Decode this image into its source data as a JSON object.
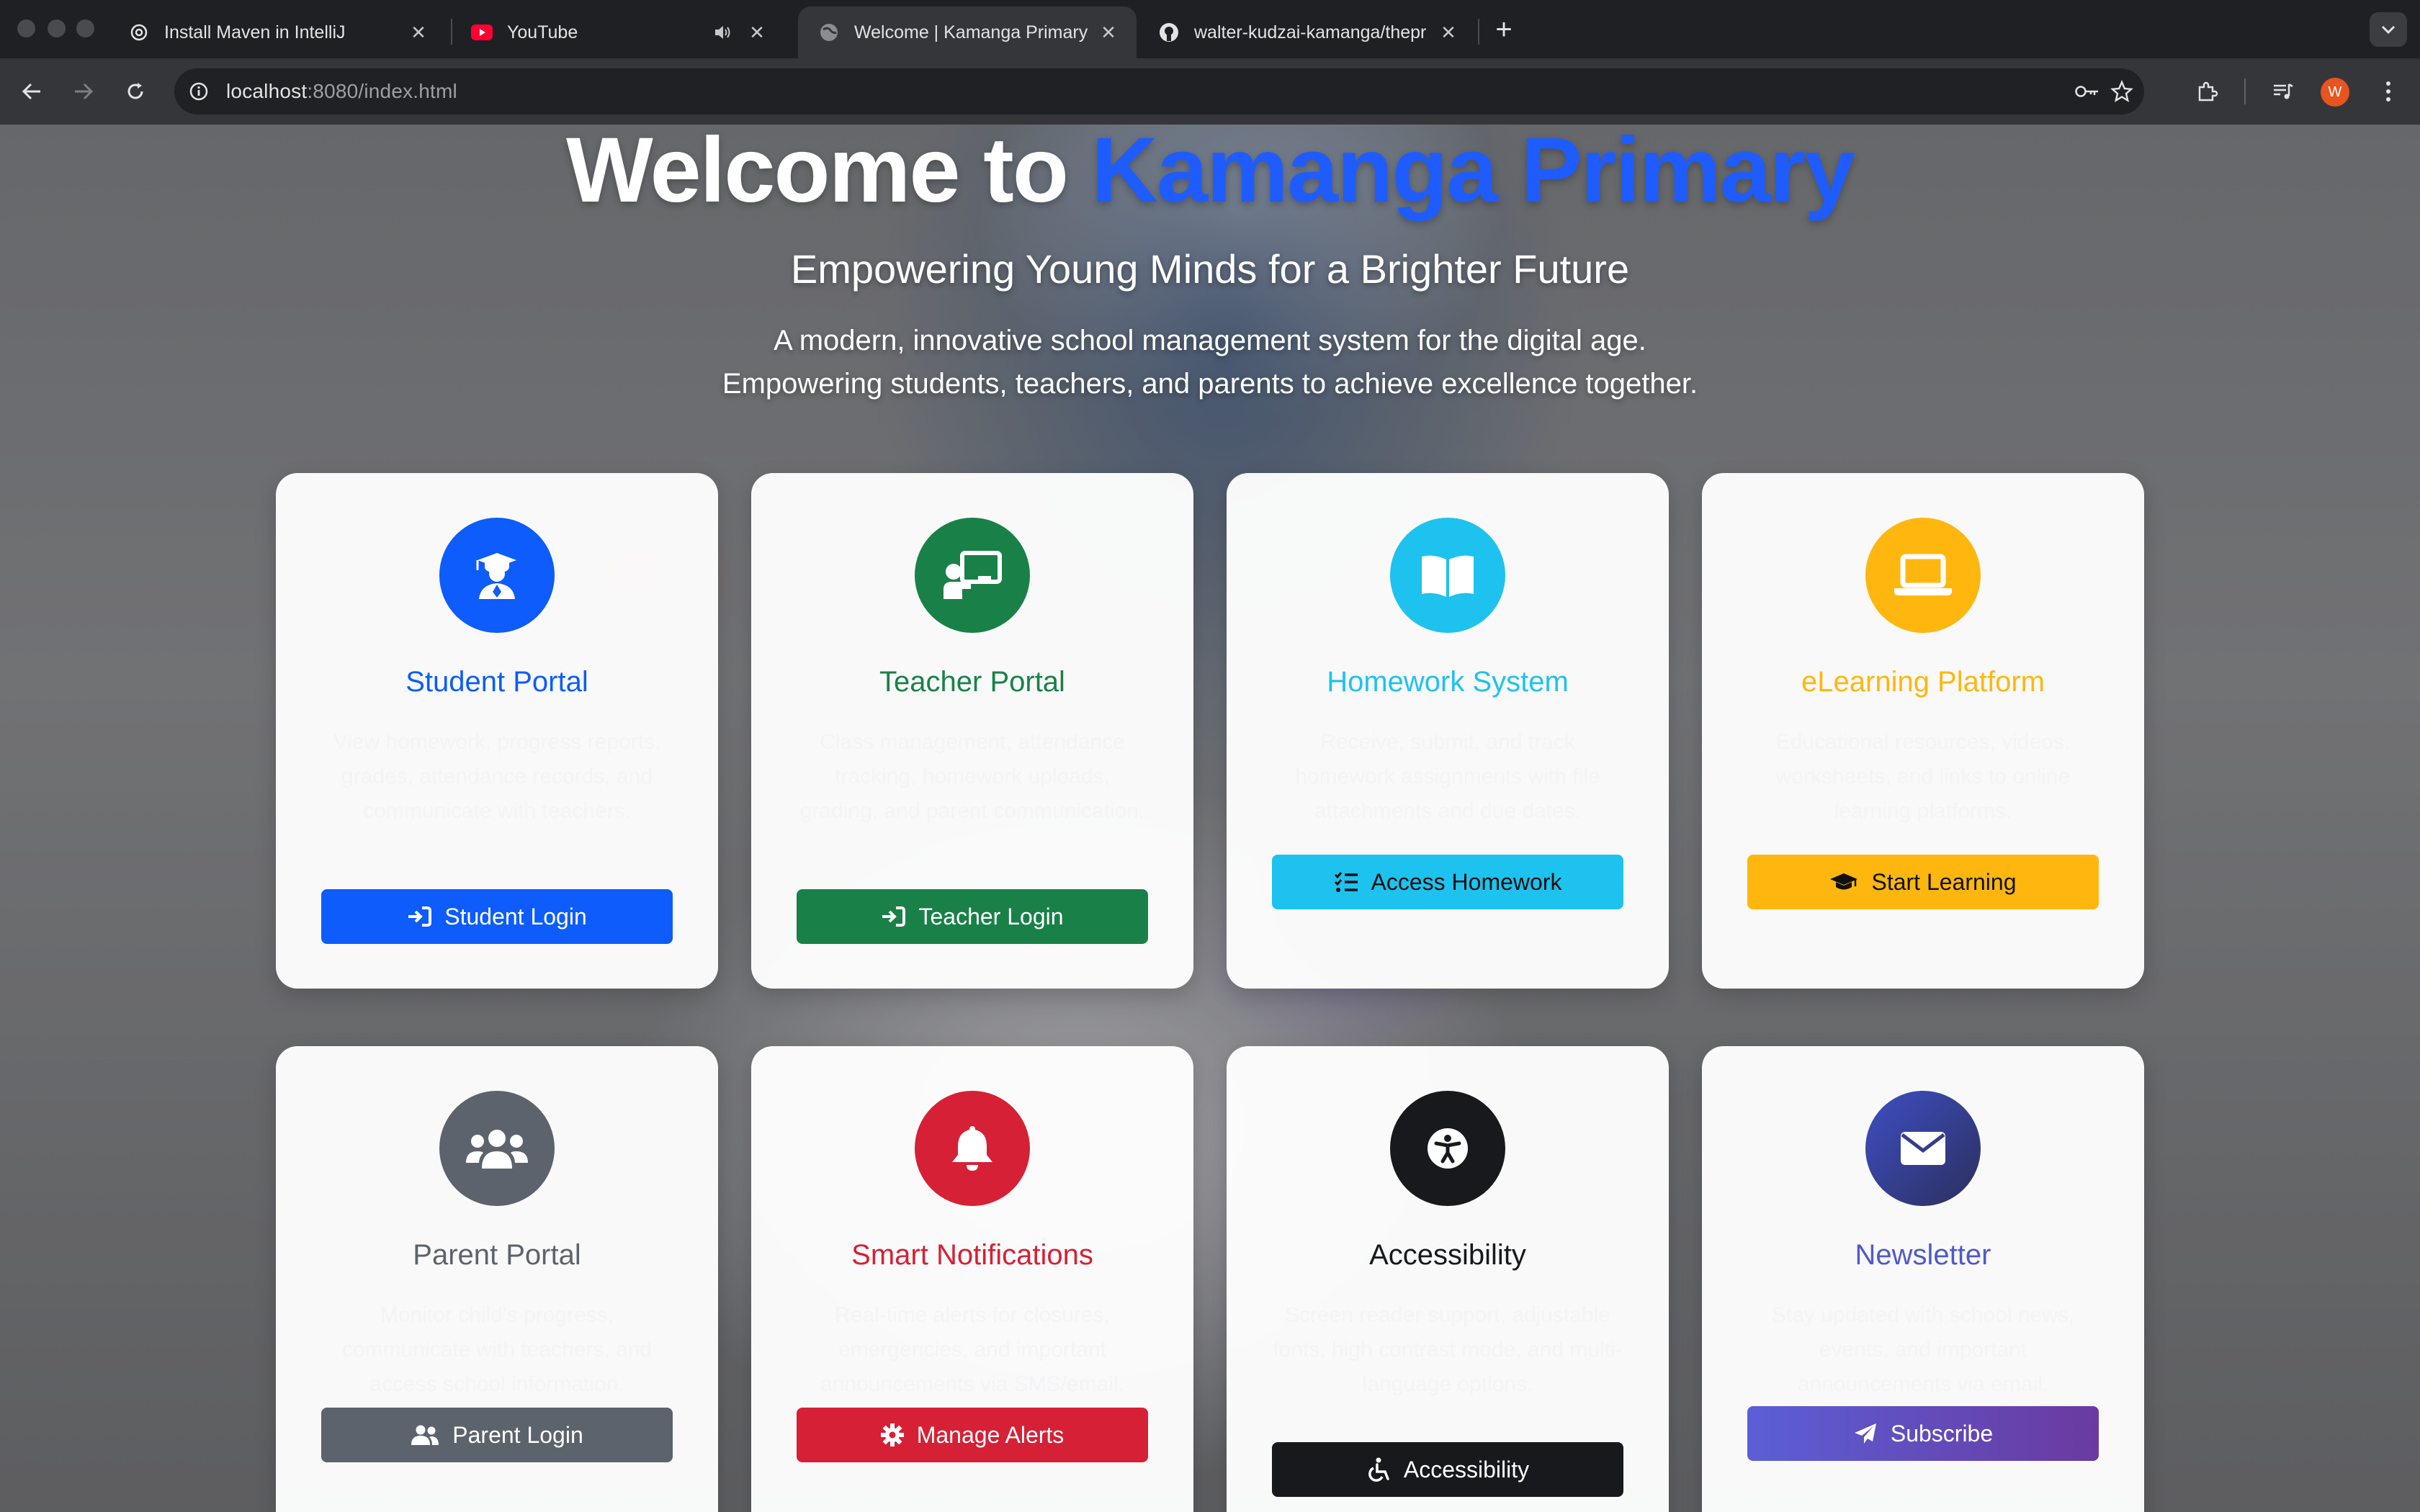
{
  "browser": {
    "tabs": [
      {
        "title": "Install Maven in IntelliJ",
        "icon": "openai-icon"
      },
      {
        "title": "YouTube",
        "icon": "youtube-icon",
        "audio": true
      },
      {
        "title": "Welcome | Kamanga Primary",
        "icon": "globe-icon",
        "active": true
      },
      {
        "title": "walter-kudzai-kamanga/thepr",
        "icon": "github-icon"
      }
    ],
    "address": {
      "host": "localhost",
      "rest": ":8080/index.html"
    },
    "profile_initial": "W",
    "profile_color": "#e8541f"
  },
  "hero": {
    "title_prefix": "Welcome to ",
    "title_accent": "Kamanga Primary",
    "subtitle": "Empowering Young Minds for a Brighter Future",
    "description_line1": "A modern, innovative school management system for the digital age.",
    "description_line2": "Empowering students, teachers, and parents to achieve excellence together."
  },
  "cards": [
    {
      "title": "Student Portal",
      "color": "#0d5cfb",
      "icon": "graduate-icon",
      "description": "View homework, progress reports, grades, attendance records, and communicate with teachers.",
      "button": "Student Login",
      "button_icon": "sign-in-icon"
    },
    {
      "title": "Teacher Portal",
      "color": "#198148",
      "icon": "chalkboard-teacher-icon",
      "description": "Class management, attendance tracking, homework uploads, grading, and parent communication.",
      "button": "Teacher Login",
      "button_icon": "sign-in-icon"
    },
    {
      "title": "Homework System",
      "color": "#1ec2ee",
      "icon": "book-open-icon",
      "description": "Receive, submit, and track homework assignments with file attachments and due dates.",
      "button": "Access Homework",
      "button_icon": "list-check-icon"
    },
    {
      "title": "eLearning Platform",
      "color": "#ffb70f",
      "icon": "laptop-icon",
      "description": "Educational resources, videos, worksheets, and links to online learning platforms.",
      "button": "Start Learning",
      "button_icon": "graduation-cap-icon"
    },
    {
      "title": "Parent Portal",
      "color": "#5d636c",
      "icon": "users-icon",
      "description": "Monitor child's progress, communicate with teachers, and access school information.",
      "button": "Parent Login",
      "button_icon": "user-friends-icon"
    },
    {
      "title": "Smart Notifications",
      "color": "#d62035",
      "icon": "bell-icon",
      "description": "Real-time alerts for closures, emergencies, and important announcements via SMS/email.",
      "button": "Manage Alerts",
      "button_icon": "cog-icon"
    },
    {
      "title": "Accessibility",
      "color": "#17191c",
      "icon": "universal-access-icon",
      "description": "Screen reader support, adjustable fonts, high contrast mode, and multi-language options.",
      "button": "Accessibility",
      "button_icon": "wheelchair-icon"
    },
    {
      "title": "Newsletter",
      "color": "#5059c8",
      "icon": "envelope-icon",
      "description": "Stay updated with school news, events, and important announcements via email.",
      "button": "Subscribe",
      "button_icon": "paper-plane-icon"
    }
  ]
}
